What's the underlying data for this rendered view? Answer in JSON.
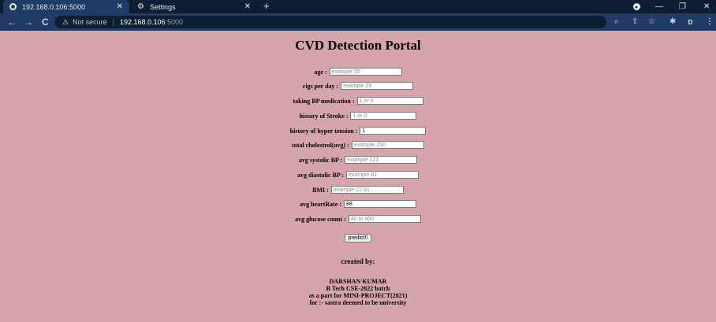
{
  "browser": {
    "tabs": [
      {
        "label": "192.168.0.106:5000",
        "active": true
      },
      {
        "label": "Settings",
        "active": false
      }
    ],
    "new_tab_label": "+",
    "url": {
      "not_secure": "Not secure",
      "host": "192.168.0.106",
      "port": ":5000"
    },
    "profile_initial": "D"
  },
  "page": {
    "title": "CVD Detection Portal",
    "fields": [
      {
        "label": "age :",
        "placeholder": "example 55",
        "value": ""
      },
      {
        "label": "cigs per day :",
        "placeholder": "example 26",
        "value": ""
      },
      {
        "label": "taking BP medication :",
        "placeholder": "1 or 0",
        "value": ""
      },
      {
        "label": "history of Stroke :",
        "placeholder": "1 or 0",
        "value": ""
      },
      {
        "label": "history of hyper tension :",
        "placeholder": "",
        "value": "1"
      },
      {
        "label": "total cholestrol(avg) :",
        "placeholder": "example 250",
        "value": ""
      },
      {
        "label": "avg systolic BP :",
        "placeholder": "example 121",
        "value": ""
      },
      {
        "label": "avg diastolic BP :",
        "placeholder": "example 81",
        "value": ""
      },
      {
        "label": "BMI :",
        "placeholder": "example 22.91",
        "value": ""
      },
      {
        "label": "avg heartRate :",
        "placeholder": "",
        "value": "88"
      },
      {
        "label": "avg glucose count :",
        "placeholder": "40 to 400",
        "value": ""
      }
    ],
    "submit_label": "predict!!",
    "credits": {
      "heading": "created by:",
      "lines": [
        "DARSHAN KUMAR",
        "B Tech CSE-2022 batch",
        "as a part for MINI-PROJECT(2021)",
        "for :- sastra deemed to be university"
      ]
    }
  }
}
